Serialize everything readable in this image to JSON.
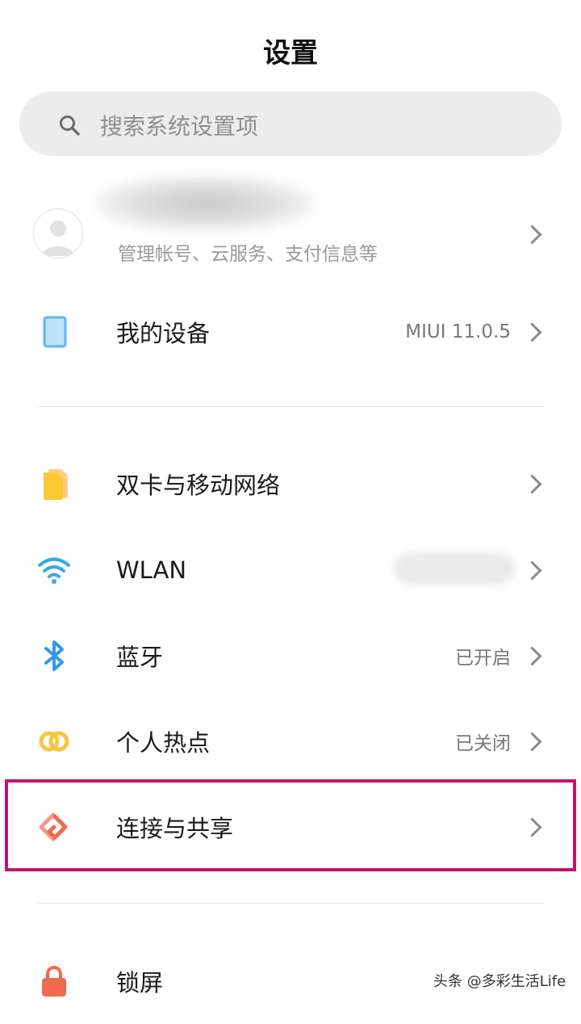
{
  "header": {
    "title": "设置"
  },
  "search": {
    "placeholder": "搜索系统设置项",
    "icon": "search-icon"
  },
  "account": {
    "subtitle": "管理帐号、云服务、支付信息等"
  },
  "rows": [
    {
      "label": "我的设备",
      "value": "MIUI 11.0.5",
      "icon": "device-icon"
    },
    {
      "label": "双卡与移动网络",
      "value": "",
      "icon": "sim-card-icon"
    },
    {
      "label": "WLAN",
      "value": "",
      "icon": "wifi-icon"
    },
    {
      "label": "蓝牙",
      "value": "已开启",
      "icon": "bluetooth-icon"
    },
    {
      "label": "个人热点",
      "value": "已关闭",
      "icon": "hotspot-icon"
    },
    {
      "label": "连接与共享",
      "value": "",
      "icon": "connection-share-icon"
    },
    {
      "label": "锁屏",
      "value": "",
      "icon": "lock-icon"
    }
  ],
  "watermark": "头条 @多彩生活Life",
  "colors": {
    "highlight": "#c6126d",
    "device": "#5bb8f0",
    "sim": "#fcc734",
    "wifi": "#3aa7ec",
    "bluetooth": "#2f9be8",
    "hotspot": "#f7c640",
    "share": "#ee6a50",
    "lock": "#f06a4e"
  }
}
